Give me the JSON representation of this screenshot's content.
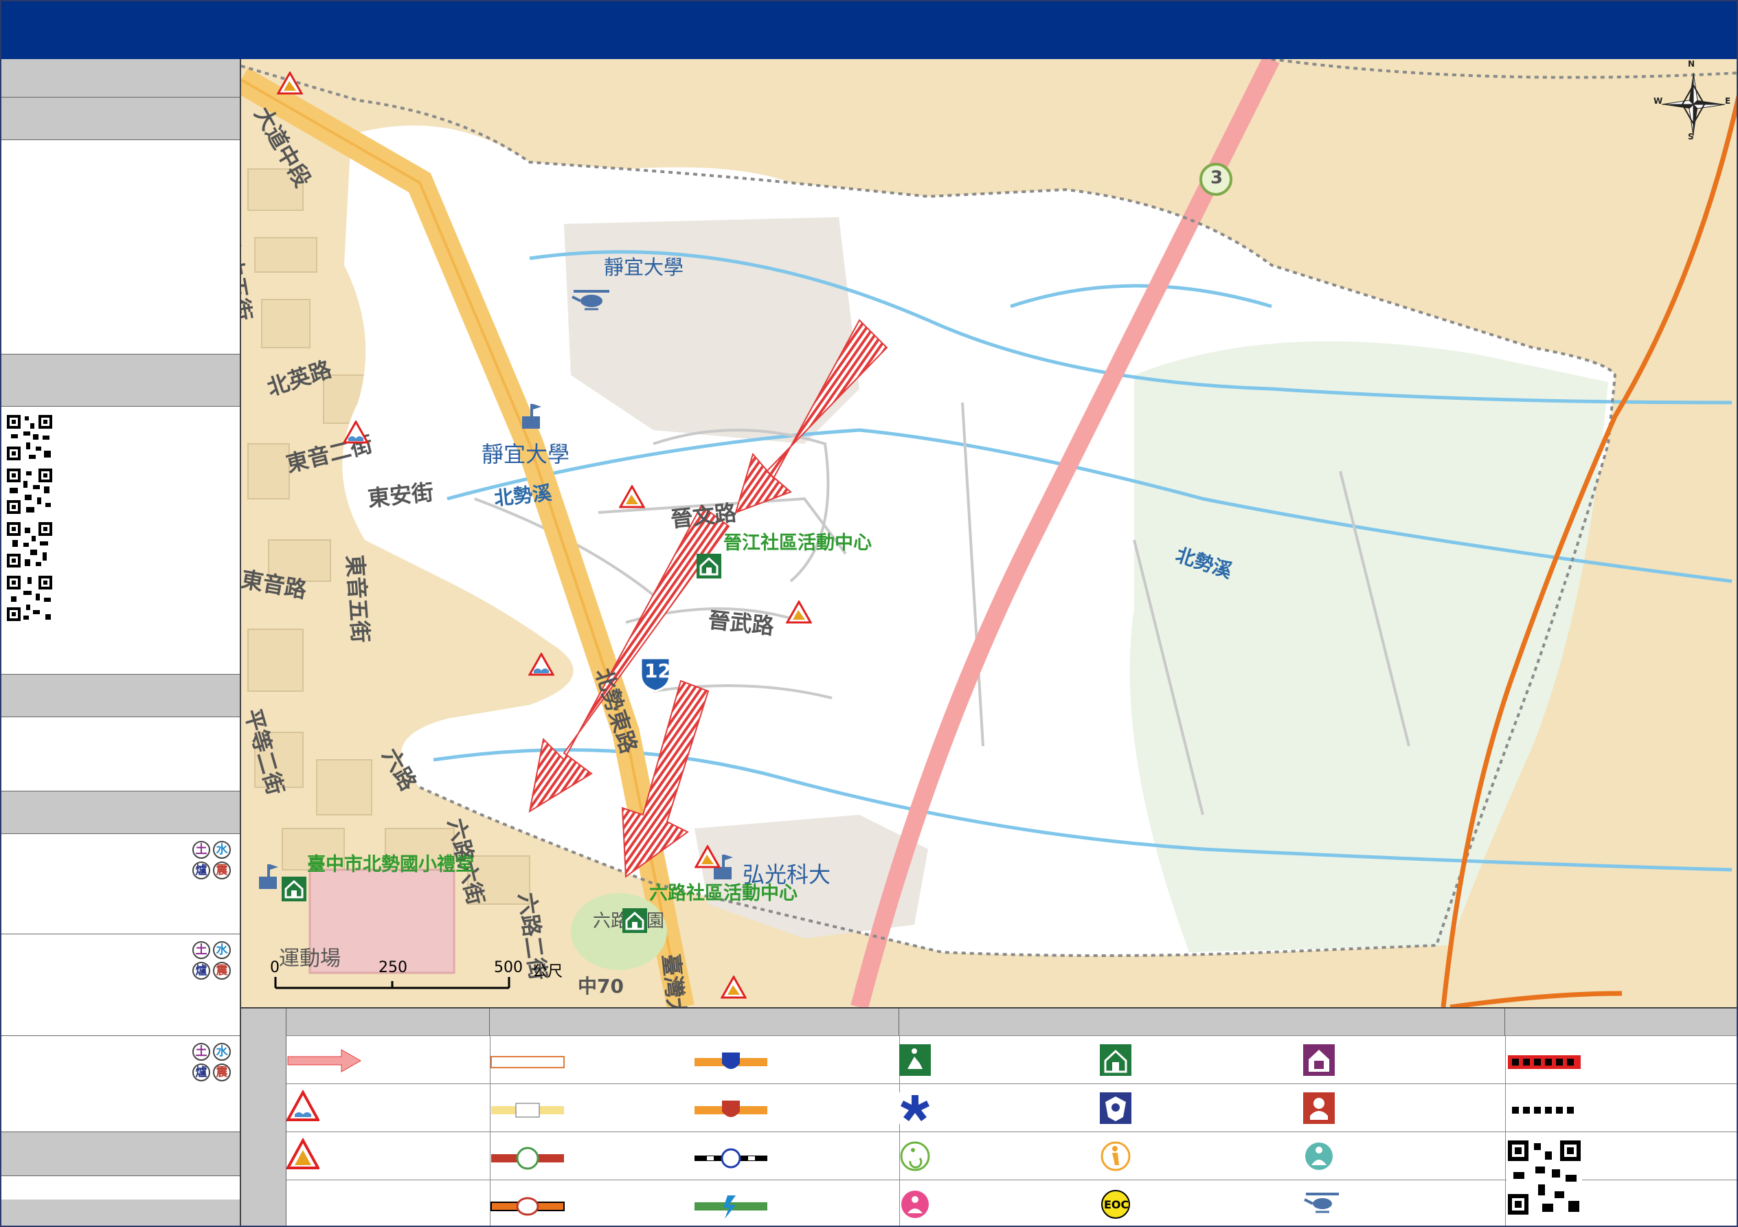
{
  "map": {
    "labels": {
      "street_north": "大道中段",
      "bei_zhong_wu": "北中五街",
      "bei_ying": "北英路",
      "dong_yin_er": "東音二街",
      "dong_an": "東安街",
      "dong_yin": "東音路",
      "dong_yin_wu": "東音五街",
      "ping_deng_er": "平等二街",
      "liu_lu": "六路",
      "liu_lu_liu": "六路六街",
      "liu_lu_er": "六路二街",
      "road_junction": "中70",
      "bei_shi_dong": "北勢東路",
      "jin_wen": "晉文路",
      "jin_wu": "晉武路",
      "jingyi_univ_top": "靜宜大學",
      "jingyi_univ": "靜宜大學",
      "hongguang": "弘光科大",
      "taiwan_blvd": "臺灣大道",
      "sports_field": "運動場",
      "park": "六路公園",
      "river_west": "北勢溪",
      "river_east": "北勢溪",
      "highway_12": "12",
      "highway_3": "3"
    },
    "shelters": {
      "jinjiang": "晉江社區活動中心",
      "liulu": "六路社區活動中心",
      "beishi": "臺中市北勢國小禮堂"
    },
    "scale": {
      "ticks": [
        "0",
        "250",
        "500"
      ],
      "unit": "公尺"
    },
    "compass": {
      "n": "N",
      "s": "S",
      "e": "E",
      "w": "W"
    }
  },
  "sidebar": {
    "hazard_badges": [
      "土",
      "水",
      "爐",
      "震"
    ]
  },
  "legend": {
    "eoc_label": "EOC"
  },
  "colors": {
    "header_blue": "#003087",
    "section_gray": "#c8c8c8",
    "map_bg": "#f3e2bc",
    "district_white": "#ffffff",
    "evac_arrow": "#e23b3b",
    "shelter_green": "#2f9a2f",
    "river_blue": "#6fc0e8",
    "orange_boundary": "#e8731c"
  },
  "icons": [
    "compass-rose-icon",
    "shelter-icon",
    "landslide-warning-icon",
    "flood-warning-icon",
    "university-icon",
    "helicopter-icon",
    "highway-shield-icon",
    "qr-code-icon",
    "evacuation-arrow-icon",
    "eoc-icon"
  ]
}
